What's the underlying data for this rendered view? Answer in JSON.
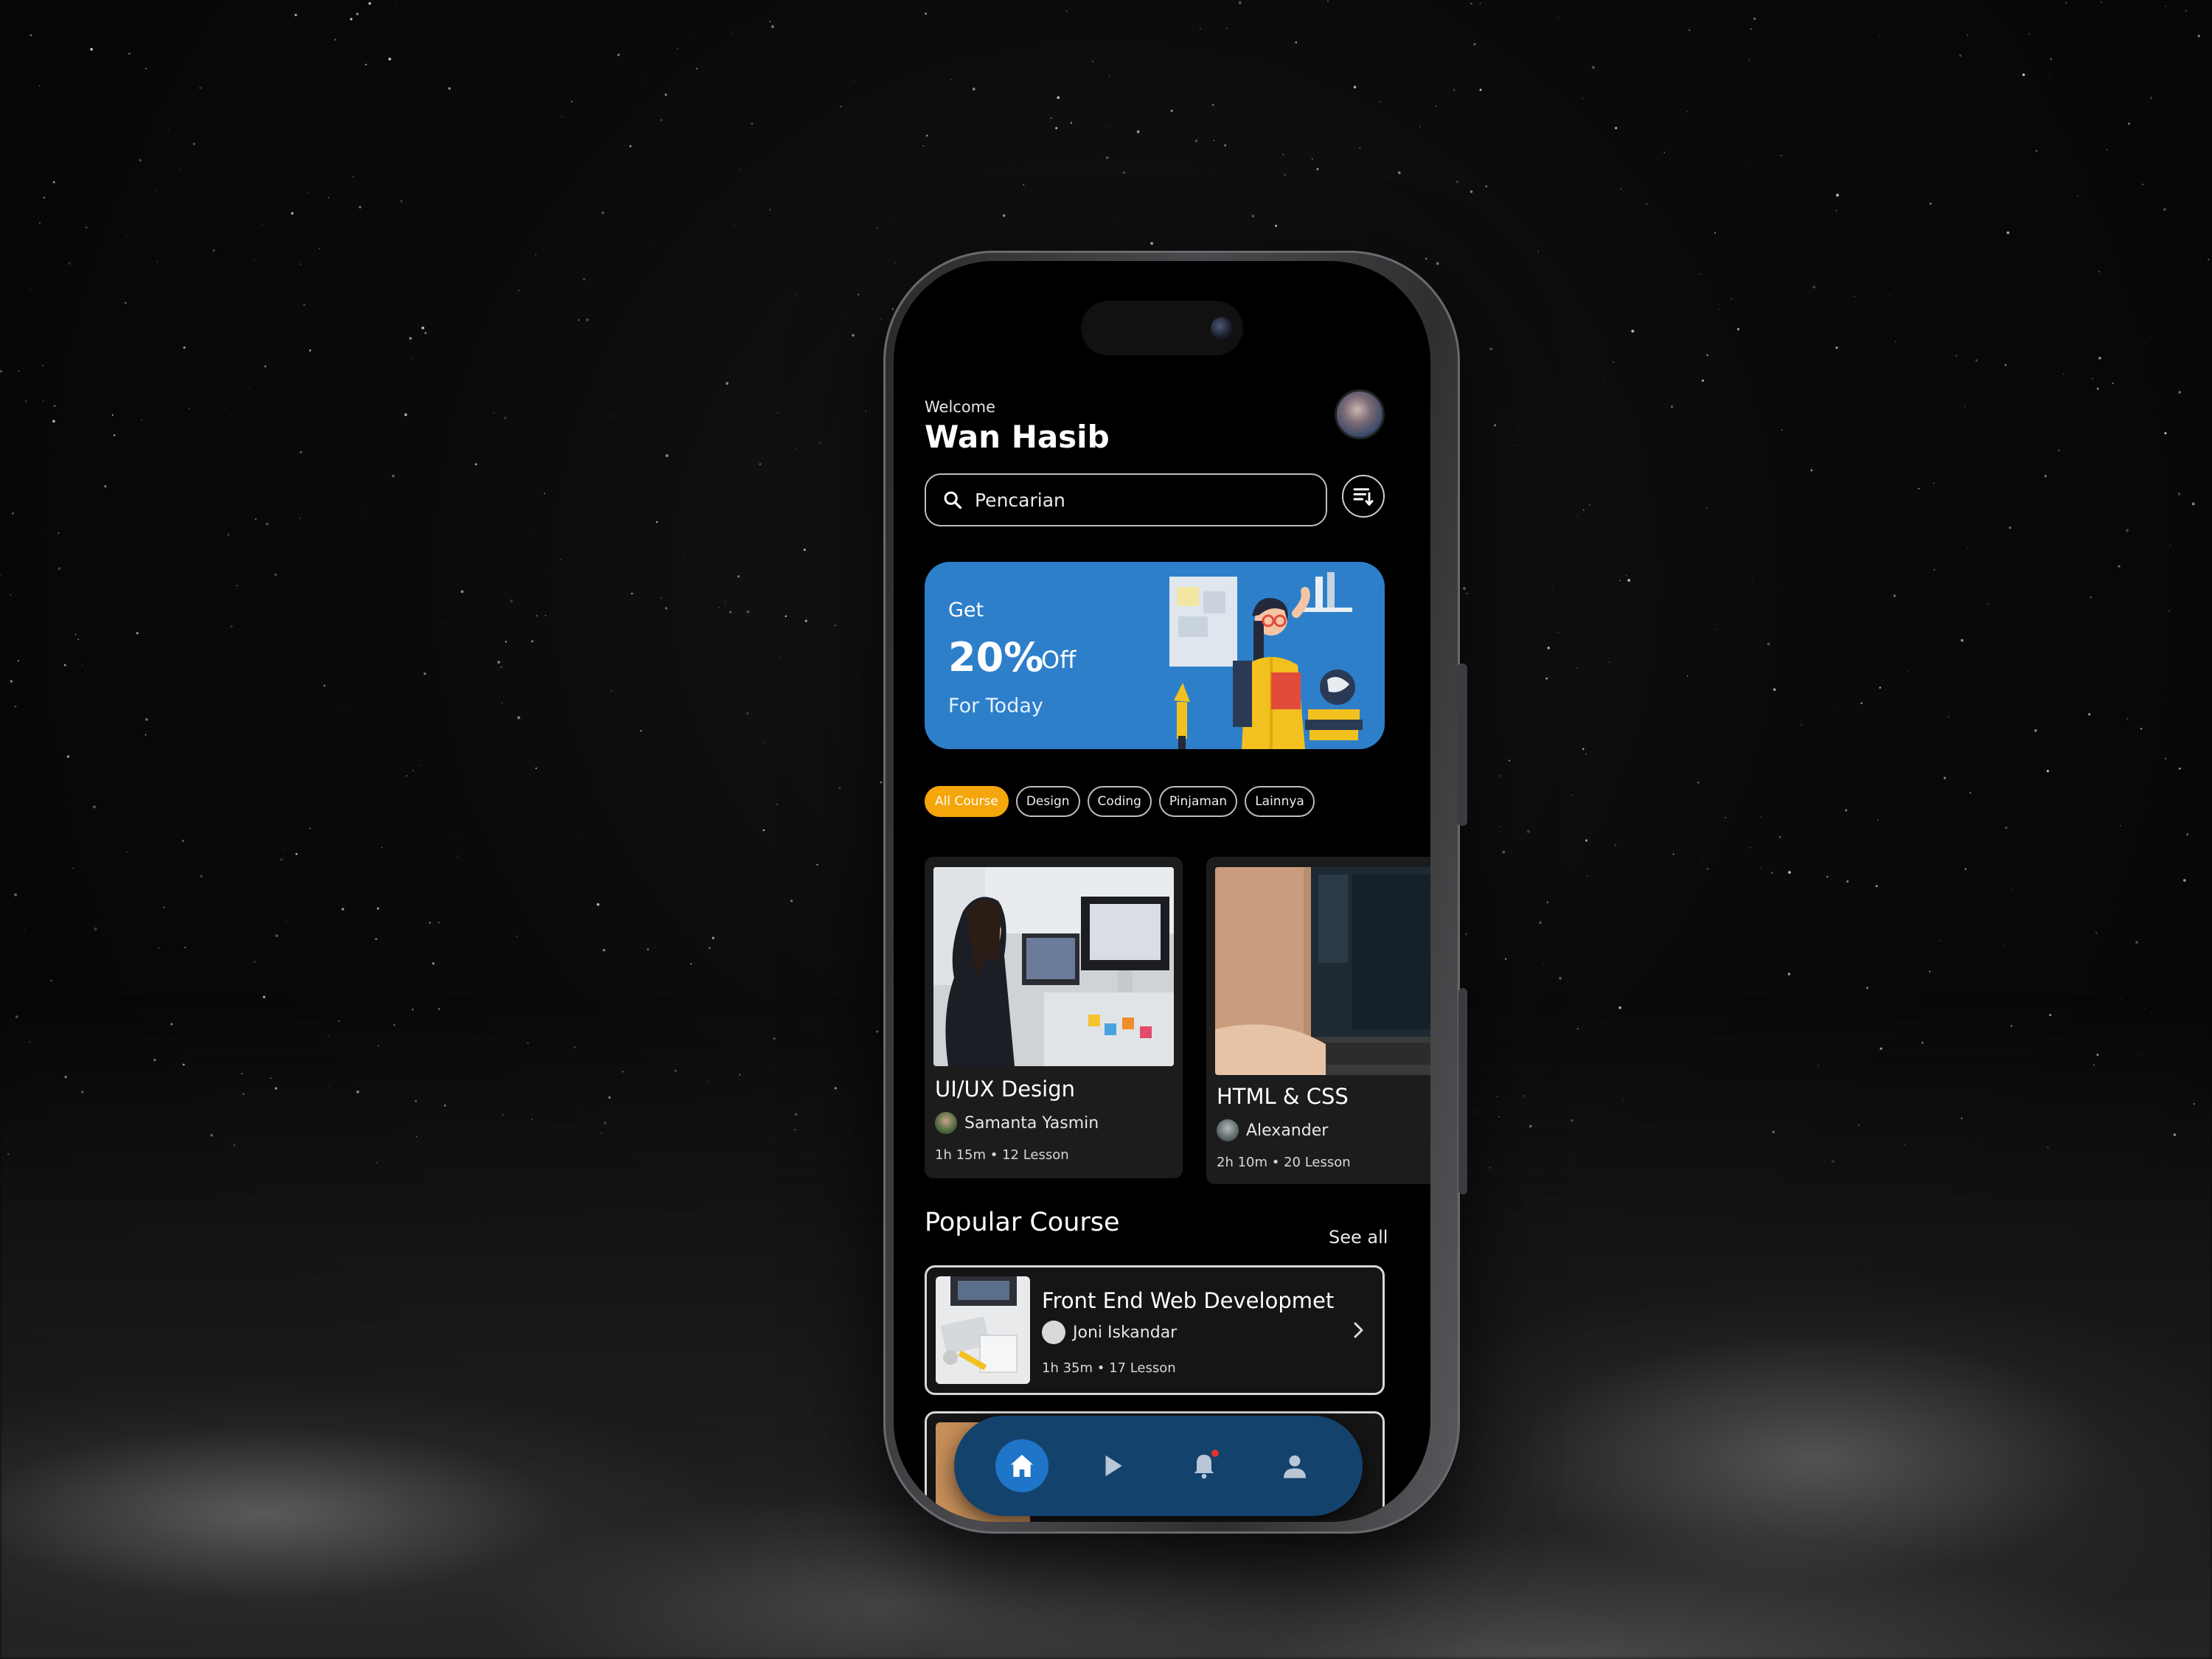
{
  "header": {
    "welcome": "Welcome",
    "user_name": "Wan Hasib"
  },
  "search": {
    "placeholder": "Pencarian"
  },
  "promo": {
    "get": "Get",
    "percent": "20%",
    "off": "Off",
    "for_today": "For Today"
  },
  "categories": [
    {
      "label": "All Course",
      "active": true
    },
    {
      "label": "Design",
      "active": false
    },
    {
      "label": "Coding",
      "active": false
    },
    {
      "label": "Pinjaman",
      "active": false
    },
    {
      "label": "Lainnya",
      "active": false
    }
  ],
  "courses": [
    {
      "title": "UI/UX Design",
      "author": "Samanta Yasmin",
      "meta": "1h 15m • 12 Lesson"
    },
    {
      "title": "HTML & CSS",
      "author": "Alexander",
      "meta": "2h 10m • 20 Lesson"
    }
  ],
  "popular": {
    "title": "Popular Course",
    "see_all": "See all",
    "items": [
      {
        "title": "Front End Web Developmet",
        "author": "Joni Iskandar",
        "meta": "1h 35m • 17 Lesson"
      }
    ]
  },
  "colors": {
    "accent_blue": "#2d7fca",
    "chip_active": "#f5a60b",
    "nav_bg": "#13426d",
    "nav_active": "#1f75c7"
  },
  "icons": {
    "search": "search-icon",
    "filter": "sort-icon",
    "home": "home-icon",
    "play": "play-icon",
    "bell": "bell-icon",
    "profile": "user-icon",
    "chevron": "chevron-right-icon"
  }
}
